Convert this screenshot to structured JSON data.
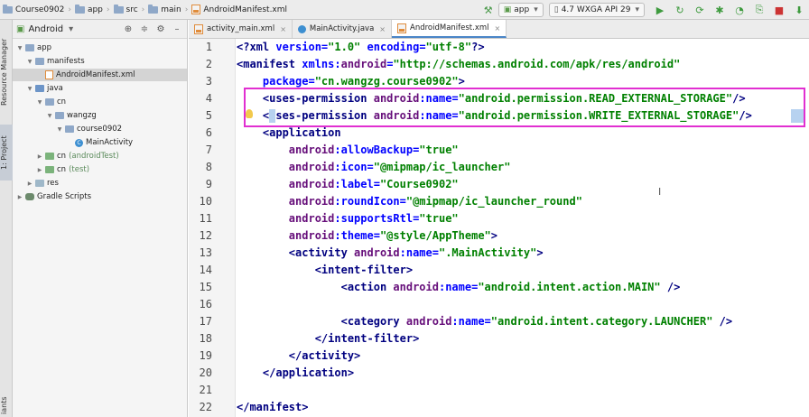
{
  "breadcrumb": [
    "Course0902",
    "app",
    "src",
    "main",
    "AndroidManifest.xml"
  ],
  "toolbar": {
    "run_config": "app",
    "device": "4.7  WXGA API 29"
  },
  "side_tabs": {
    "resource_manager": "Resource Manager",
    "project": "1: Project",
    "variants": "iants"
  },
  "project_panel": {
    "view": "Android",
    "items": [
      {
        "label": "app",
        "level": 0,
        "kind": "folder",
        "expanded": true
      },
      {
        "label": "manifests",
        "level": 1,
        "kind": "folder",
        "expanded": true
      },
      {
        "label": "AndroidManifest.xml",
        "level": 2,
        "kind": "xml",
        "selected": true
      },
      {
        "label": "java",
        "level": 1,
        "kind": "java",
        "expanded": true
      },
      {
        "label": "cn",
        "level": 2,
        "kind": "folder",
        "expanded": true
      },
      {
        "label": "wangzg",
        "level": 3,
        "kind": "folder",
        "expanded": true
      },
      {
        "label": "course0902",
        "level": 4,
        "kind": "folder",
        "expanded": true
      },
      {
        "label": "MainActivity",
        "level": 5,
        "kind": "class"
      },
      {
        "label": "cn",
        "suffix": "(androidTest)",
        "level": 2,
        "kind": "test"
      },
      {
        "label": "cn",
        "suffix": "(test)",
        "level": 2,
        "kind": "test"
      },
      {
        "label": "res",
        "level": 1,
        "kind": "res"
      },
      {
        "label": "Gradle Scripts",
        "level": 0,
        "kind": "gradle"
      }
    ]
  },
  "tabs": [
    {
      "label": "activity_main.xml",
      "kind": "xml",
      "active": false
    },
    {
      "label": "MainActivity.java",
      "kind": "java",
      "active": false
    },
    {
      "label": "AndroidManifest.xml",
      "kind": "xml",
      "active": true
    }
  ],
  "editor": {
    "line_numbers": [
      "1",
      "2",
      "3",
      "4",
      "5",
      "6",
      "7",
      "8",
      "9",
      "10",
      "11",
      "12",
      "13",
      "14",
      "15",
      "16",
      "17",
      "18",
      "19",
      "20",
      "21",
      "22"
    ],
    "lines": [
      {
        "indent": "",
        "tokens": [
          [
            "tag",
            "<?xml "
          ],
          [
            "attr",
            "version="
          ],
          [
            "val",
            "\"1.0\""
          ],
          [
            "plain",
            " "
          ],
          [
            "attr",
            "encoding="
          ],
          [
            "val",
            "\"utf-8\""
          ],
          [
            "tag",
            "?>"
          ]
        ]
      },
      {
        "indent": "",
        "tokens": [
          [
            "tag",
            "<manifest "
          ],
          [
            "attr",
            "xmlns:"
          ],
          [
            "ns",
            "android"
          ],
          [
            "attr",
            "="
          ],
          [
            "val",
            "\"http://schemas.android.com/apk/res/android\""
          ]
        ]
      },
      {
        "indent": "    ",
        "tokens": [
          [
            "attr",
            "package="
          ],
          [
            "val",
            "\"cn.wangzg.course0902\""
          ],
          [
            "tag",
            ">"
          ]
        ]
      },
      {
        "indent": "    ",
        "tokens": [
          [
            "tag",
            "<uses-permission "
          ],
          [
            "ns",
            "android"
          ],
          [
            "attr",
            ":name="
          ],
          [
            "val",
            "\"android.permission.READ_EXTERNAL_STORAGE\""
          ],
          [
            "tag",
            "/>"
          ]
        ]
      },
      {
        "indent": "    ",
        "tokens": [
          [
            "tag",
            "<uses-permission "
          ],
          [
            "ns",
            "android"
          ],
          [
            "attr",
            ":name="
          ],
          [
            "val",
            "\"android.permission.WRITE_EXTERNAL_STORAGE\""
          ],
          [
            "tag",
            "/>"
          ]
        ]
      },
      {
        "indent": "    ",
        "tokens": [
          [
            "tag",
            "<application"
          ]
        ]
      },
      {
        "indent": "        ",
        "tokens": [
          [
            "ns",
            "android"
          ],
          [
            "attr",
            ":allowBackup="
          ],
          [
            "val",
            "\"true\""
          ]
        ]
      },
      {
        "indent": "        ",
        "tokens": [
          [
            "ns",
            "android"
          ],
          [
            "attr",
            ":icon="
          ],
          [
            "val",
            "\"@mipmap/ic_launcher\""
          ]
        ]
      },
      {
        "indent": "        ",
        "tokens": [
          [
            "ns",
            "android"
          ],
          [
            "attr",
            ":label="
          ],
          [
            "val",
            "\"Course0902\""
          ]
        ]
      },
      {
        "indent": "        ",
        "tokens": [
          [
            "ns",
            "android"
          ],
          [
            "attr",
            ":roundIcon="
          ],
          [
            "val",
            "\"@mipmap/ic_launcher_round\""
          ]
        ]
      },
      {
        "indent": "        ",
        "tokens": [
          [
            "ns",
            "android"
          ],
          [
            "attr",
            ":supportsRtl="
          ],
          [
            "val",
            "\"true\""
          ]
        ]
      },
      {
        "indent": "        ",
        "tokens": [
          [
            "ns",
            "android"
          ],
          [
            "attr",
            ":theme="
          ],
          [
            "val",
            "\"@style/AppTheme\""
          ],
          [
            "tag",
            ">"
          ]
        ]
      },
      {
        "indent": "        ",
        "tokens": [
          [
            "tag",
            "<activity "
          ],
          [
            "ns",
            "android"
          ],
          [
            "attr",
            ":name="
          ],
          [
            "val",
            "\".MainActivity\""
          ],
          [
            "tag",
            ">"
          ]
        ]
      },
      {
        "indent": "            ",
        "tokens": [
          [
            "tag",
            "<intent-filter>"
          ]
        ]
      },
      {
        "indent": "                ",
        "tokens": [
          [
            "tag",
            "<action "
          ],
          [
            "ns",
            "android"
          ],
          [
            "attr",
            ":name="
          ],
          [
            "val",
            "\"android.intent.action.MAIN\""
          ],
          [
            "tag",
            " />"
          ]
        ]
      },
      {
        "indent": "",
        "tokens": []
      },
      {
        "indent": "                ",
        "tokens": [
          [
            "tag",
            "<category "
          ],
          [
            "ns",
            "android"
          ],
          [
            "attr",
            ":name="
          ],
          [
            "val",
            "\"android.intent.category.LAUNCHER\""
          ],
          [
            "tag",
            " />"
          ]
        ]
      },
      {
        "indent": "            ",
        "tokens": [
          [
            "tag",
            "</intent-filter>"
          ]
        ]
      },
      {
        "indent": "        ",
        "tokens": [
          [
            "tag",
            "</activity>"
          ]
        ]
      },
      {
        "indent": "    ",
        "tokens": [
          [
            "tag",
            "</application>"
          ]
        ]
      },
      {
        "indent": "",
        "tokens": []
      },
      {
        "indent": "",
        "tokens": [
          [
            "tag",
            "</manifest>"
          ]
        ]
      }
    ]
  },
  "colors": {
    "highlight_box": "#e12fd1",
    "tag": "#000080",
    "attribute": "#0000ff",
    "namespace": "#660e7a",
    "value": "#008000"
  }
}
